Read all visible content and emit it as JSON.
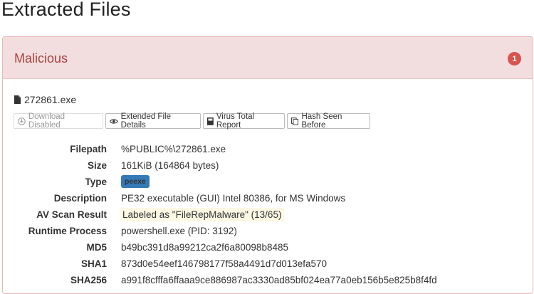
{
  "page": {
    "title": "Extracted Files"
  },
  "panel": {
    "heading": "Malicious",
    "count": "1"
  },
  "file": {
    "name": "272861.exe"
  },
  "buttons": {
    "download": "Download Disabled",
    "extended": "Extended File Details",
    "virustotal": "Virus Total Report",
    "hash": "Hash Seen Before"
  },
  "details": [
    {
      "label": "Filepath",
      "value": "%PUBLIC%\\272861.exe"
    },
    {
      "label": "Size",
      "value": "161KiB (164864 bytes)"
    },
    {
      "label": "Type",
      "value": "peexe"
    },
    {
      "label": "Description",
      "value": "PE32 executable (GUI) Intel 80386, for MS Windows"
    },
    {
      "label": "AV Scan Result",
      "value": "Labeled as \"FileRepMalware\" (13/65)"
    },
    {
      "label": "Runtime Process",
      "value": "powershell.exe (PID: 3192)"
    },
    {
      "label": "MD5",
      "value": "b49bc391d8a99212ca2f6a80098b8485"
    },
    {
      "label": "SHA1",
      "value": "873d0e54eef146798177f58a4491d7d013efa570"
    },
    {
      "label": "SHA256",
      "value": "a991f8cfffa6ffaaa9ce886987ac3330ad85bf024ea77a0eb156b5e825b8f4fd"
    }
  ],
  "colors": {
    "danger_heading_bg": "#f2dede",
    "danger_text": "#a94442",
    "badge_red": "#d9534f",
    "type_badge_blue": "#337ab7",
    "av_highlight": "#fcf8e3"
  }
}
